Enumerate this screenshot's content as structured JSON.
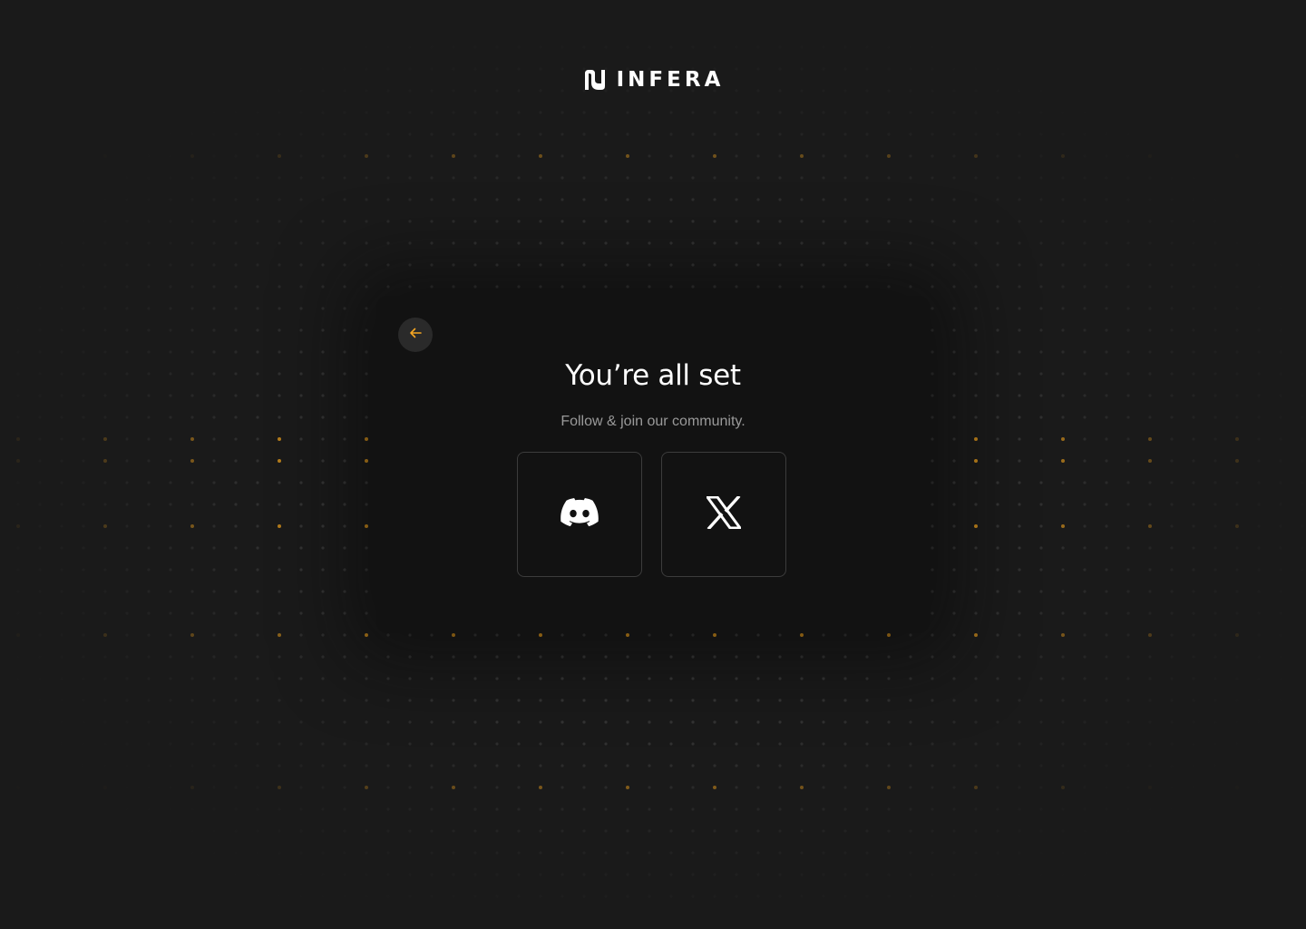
{
  "brand": {
    "name": "INFERA",
    "logo_icon": "infera-logo-icon"
  },
  "card": {
    "back_icon": "arrow-left-icon",
    "title": "You’re all set",
    "subtitle": "Follow & join our community.",
    "socials": [
      {
        "icon": "discord-icon"
      },
      {
        "icon": "x-twitter-icon"
      }
    ]
  },
  "colors": {
    "background": "#1a1a1a",
    "card": "#121212",
    "accent": "#f5a623",
    "dot_gray": "#3a3a3a",
    "dot_accent": "#e39a1c",
    "text_primary": "#ffffff",
    "text_secondary": "#9a9a9a"
  }
}
